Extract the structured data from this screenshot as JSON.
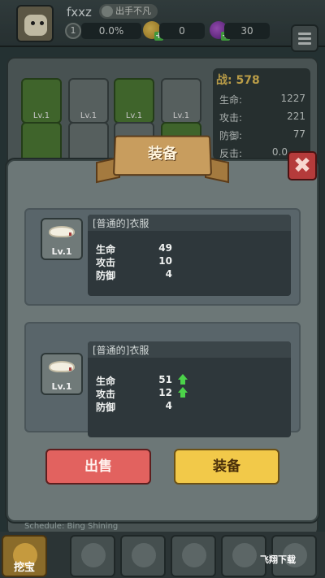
{
  "player": {
    "name": "fxxz",
    "title": "出手不凡",
    "level": "1",
    "exp": "0.0%",
    "gold": "0",
    "gems": "30"
  },
  "stats": {
    "power_label": "战:",
    "power_value": "578",
    "hp_label": "生命:",
    "hp_value": "1227",
    "atk_label": "攻击:",
    "atk_value": "221",
    "def_label": "防御:",
    "def_value": "77",
    "counter_label": "反击:",
    "counter_value": "0.0"
  },
  "slots": {
    "lv": "Lv.1"
  },
  "modal": {
    "title": "装备",
    "close": "✖",
    "current": {
      "name": "[普通的]衣服",
      "level": "Lv.1",
      "rows": [
        {
          "label": "生命",
          "value": "49"
        },
        {
          "label": "攻击",
          "value": "10"
        },
        {
          "label": "防御",
          "value": "4"
        }
      ]
    },
    "new": {
      "name": "[普通的]衣服",
      "level": "Lv.1",
      "rows": [
        {
          "label": "生命",
          "value": "51",
          "up": true
        },
        {
          "label": "攻击",
          "value": "12",
          "up": true
        },
        {
          "label": "防御",
          "value": "4",
          "up": false
        }
      ]
    },
    "sell_label": "出售",
    "equip_label": "装备"
  },
  "nav": {
    "notice": "Schedule: Bing Shining",
    "dig_label": "挖宝"
  },
  "watermark": "飞翔下载",
  "colors": {
    "sell": "#e2625f",
    "equip": "#f2c949",
    "up_arrow": "#4cd34a",
    "power": "#e2bf57"
  }
}
